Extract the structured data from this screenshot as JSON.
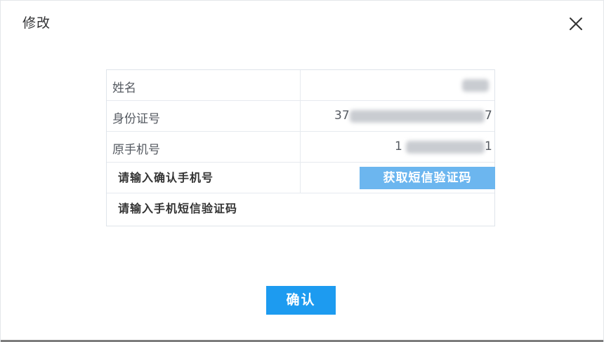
{
  "dialog": {
    "title": "修改",
    "close_icon": "close-icon"
  },
  "table": {
    "rows": [
      {
        "label": "姓名",
        "value_prefix": "",
        "value_suffix": ""
      },
      {
        "label": "身份证号",
        "value_prefix": "37",
        "value_suffix": "7"
      },
      {
        "label": "原手机号",
        "value_prefix": "1",
        "value_suffix": "1"
      }
    ],
    "confirm_phone_label": "请输入确认手机号",
    "sms_code_label": "请输入手机短信验证码",
    "get_sms_code_button": "获取短信验证码"
  },
  "actions": {
    "confirm_button": "确认"
  },
  "colors": {
    "primary": "#1d9bf0",
    "sms_button": "#6cb6ef"
  }
}
